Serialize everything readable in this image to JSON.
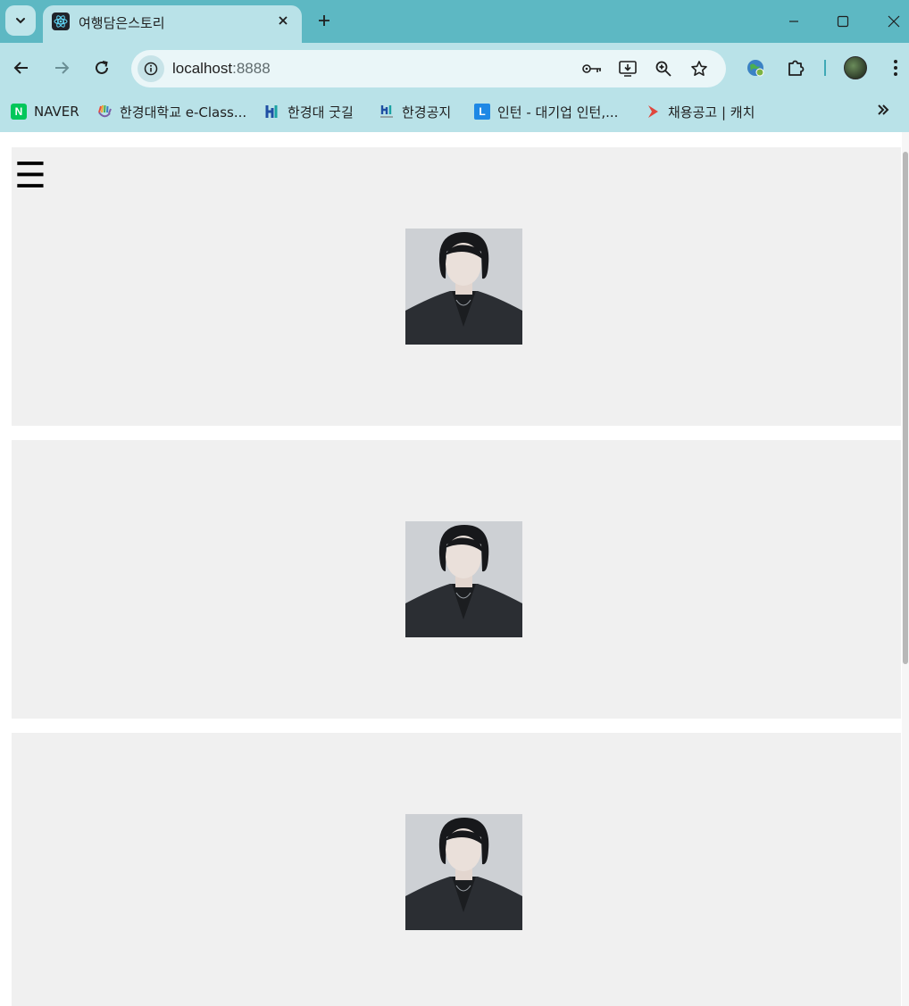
{
  "browser": {
    "tab": {
      "title": "여행담은스토리"
    },
    "address": {
      "host": "localhost",
      "port": ":8888"
    },
    "bookmarks": [
      {
        "label": "NAVER",
        "icon": "naver-icon",
        "color": "#03c75a"
      },
      {
        "label": "한경대학교 e-Class...",
        "icon": "eclass-hand-icon",
        "color": "#7b5ea7"
      },
      {
        "label": "한경대 굿길",
        "icon": "hknu-logo-icon",
        "color": "#1f4fa3"
      },
      {
        "label": "한경공지",
        "icon": "hknu-logo-small-icon",
        "color": "#1f4fa3"
      },
      {
        "label": "인턴 - 대기업 인턴,...",
        "icon": "linkareer-icon",
        "color": "#1e88e5"
      },
      {
        "label": "채용공고 | 캐치",
        "icon": "catch-arrow-icon",
        "color": "#e0463c"
      }
    ]
  },
  "page": {
    "menu_glyph": "☰",
    "cards": [
      {
        "has_menu": true
      },
      {
        "has_menu": false
      },
      {
        "has_menu": false
      }
    ]
  },
  "colors": {
    "tabstrip": "#5db8c3",
    "toolbar": "#b9e2e8",
    "card": "#f0f0f0"
  }
}
